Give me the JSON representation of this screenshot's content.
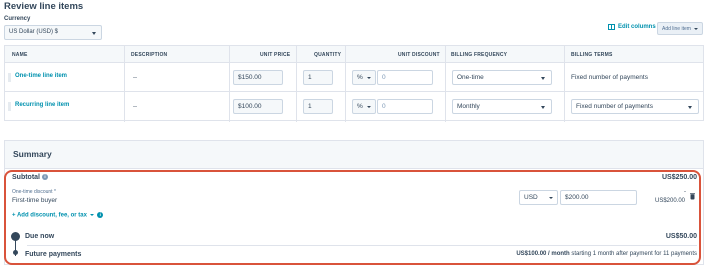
{
  "page": {
    "title": "Review line items"
  },
  "currency": {
    "label": "Currency",
    "value": "US Dollar (USD) $"
  },
  "toolbar": {
    "edit_columns": "Edit columns",
    "add_line_item": "Add line item"
  },
  "table": {
    "headers": [
      "NAME",
      "DESCRIPTION",
      "UNIT PRICE",
      "QUANTITY",
      "UNIT DISCOUNT",
      "BILLING FREQUENCY",
      "BILLING TERMS"
    ],
    "rows": [
      {
        "name": "One-time line item",
        "description": "--",
        "unit_price": "$150.00",
        "quantity": "1",
        "discount_type": "%",
        "discount_value": "0",
        "billing_frequency": "One-time",
        "billing_terms": "Fixed number of payments"
      },
      {
        "name": "Recurring line item",
        "description": "--",
        "unit_price": "$100.00",
        "quantity": "1",
        "discount_type": "%",
        "discount_value": "0",
        "billing_frequency": "Monthly",
        "billing_terms": "Fixed number of payments"
      }
    ]
  },
  "summary": {
    "title": "Summary",
    "subtotal_label": "Subtotal",
    "subtotal_value": "US$250.00",
    "discount": {
      "label": "One-time discount *",
      "name": "First-time buyer",
      "currency": "USD",
      "amount": "$200.00",
      "result_sign": "-",
      "result_value": "US$200.00"
    },
    "add_discount": "+ Add discount, fee, or tax",
    "due_now_label": "Due now",
    "due_now_value": "US$50.00",
    "future_label": "Future payments",
    "future_amount": "US$100.00 / month",
    "future_desc": " starting 1 month after payment for 11 payments"
  },
  "colors": {
    "accent": "#0091ae",
    "highlight": "#d9533b",
    "text": "#33475b"
  }
}
